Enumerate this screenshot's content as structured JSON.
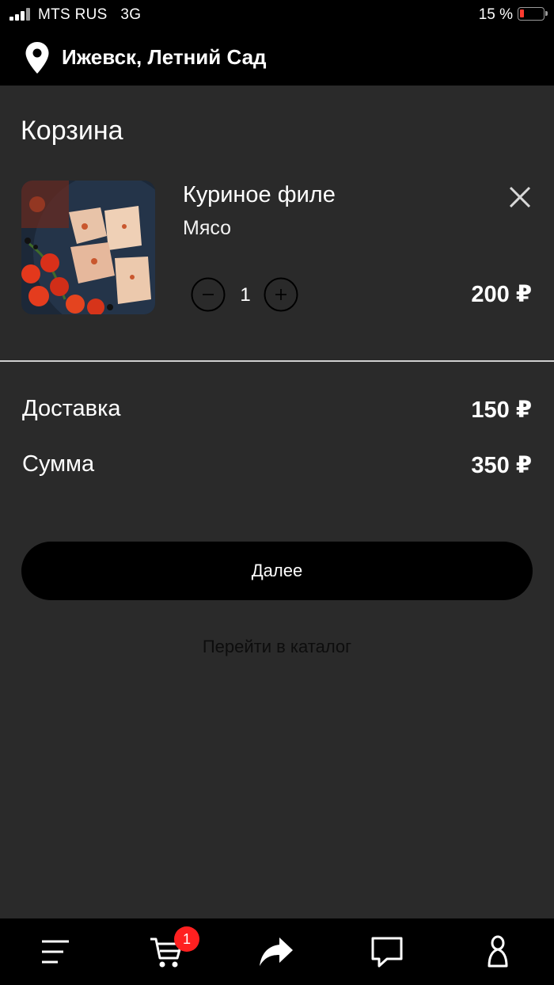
{
  "status_bar": {
    "carrier": "MTS RUS",
    "network": "3G",
    "battery_percent": "15 %",
    "battery_color": "#ff3b30"
  },
  "location": {
    "icon": "location-pin-icon",
    "text": "Ижевск, Летний Сад"
  },
  "cart": {
    "title": "Корзина",
    "items": [
      {
        "name": "Куриное филе",
        "category": "Мясо",
        "quantity": "1",
        "price": "200 ₽",
        "image": "chicken-fillet-with-tomatoes"
      }
    ],
    "delivery_label": "Доставка",
    "delivery_value": "150 ₽",
    "total_label": "Сумма",
    "total_value": "350 ₽",
    "next_button": "Далее",
    "catalog_link": "Перейти в каталог"
  },
  "tab_bar": {
    "items": [
      "menu-icon",
      "cart-icon",
      "share-icon",
      "chat-icon",
      "profile-icon"
    ],
    "cart_badge": "1",
    "badge_color": "#ff2020"
  }
}
